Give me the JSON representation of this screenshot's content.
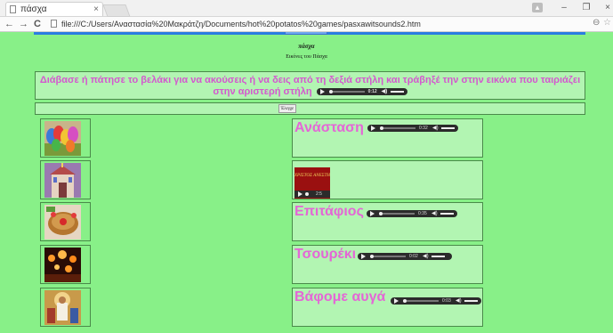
{
  "browser": {
    "tab_title": "πάσχα",
    "tab_close": "×",
    "back": "←",
    "forward": "→",
    "reload": "C",
    "url": "file:///C:/Users/Αναστασία%20Μακράτζη/Documents/hot%20potatos%20games/pasxawitsounds2.htm",
    "minimize": "–",
    "maximize": "❐",
    "close": "×",
    "zoom_icon": "⊖",
    "star_icon": "☆"
  },
  "page": {
    "title": "πάσχα",
    "subtitle": "Εικόνες του Πάσχα",
    "instructions": "Διάβασε ή πάτησε το βελάκι για να ακούσεις ή να δεις από τη δεξιά στήλη και τράβηξέ την στην εικόνα που ταιριάζει στην αριστερή στήλη",
    "instructions_player_time": "0:12",
    "check_button": "Έλεγχε"
  },
  "rows": [
    {
      "image": "easter-eggs",
      "label": "Ανάσταση",
      "time": "0:32"
    },
    {
      "image": "church",
      "label": "",
      "card_text": "ΧΡΙΣΤΟΣ ΑΝΕΣΤΗ",
      "time": "2:5"
    },
    {
      "image": "easter-bread",
      "label": "Επιτάφιος",
      "time": "0:35"
    },
    {
      "image": "candles-night",
      "label": "Τσουρέκι",
      "time": "0:02"
    },
    {
      "image": "resurrection-icon",
      "label": "Βάφομε αυγά",
      "time": "0:03"
    }
  ],
  "colors": {
    "page_bg": "#88f088",
    "cell_bg": "#b2f5b2",
    "label_pink": "#e466d6",
    "instructions_pink": "#d458cf",
    "accent_blue": "#2a7de1"
  }
}
